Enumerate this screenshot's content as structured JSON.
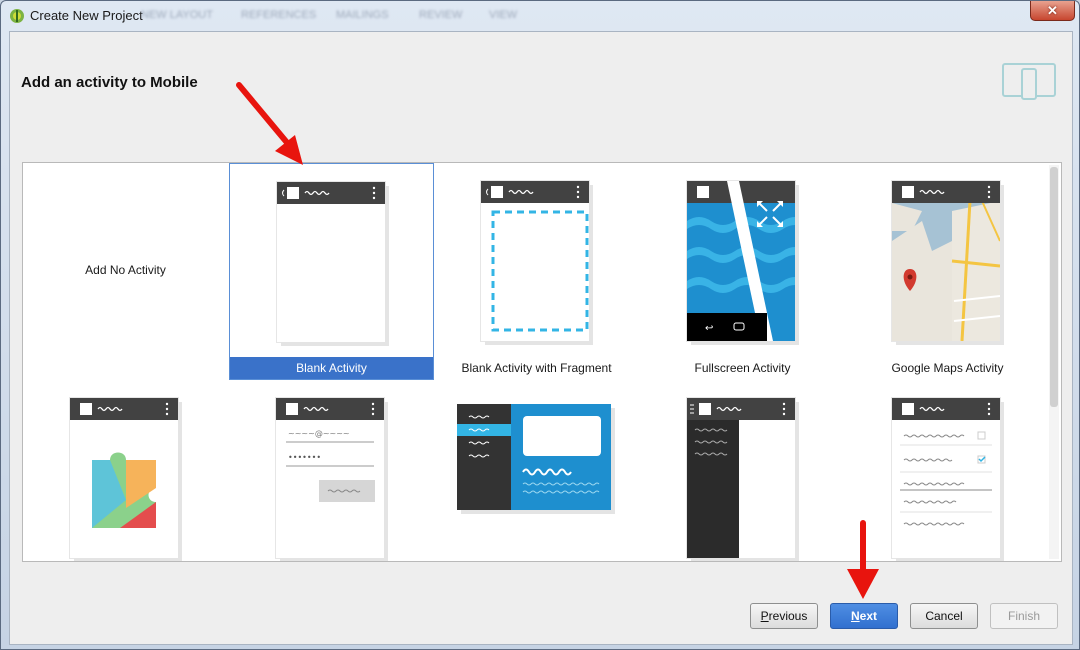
{
  "window": {
    "title": "Create New Project",
    "background_menu": [
      "NEW LAYOUT",
      "REFERENCES",
      "MAILINGS",
      "REVIEW",
      "VIEW"
    ]
  },
  "dialog": {
    "heading": "Add an activity to Mobile",
    "device_icon": "tablet-phone-icon"
  },
  "gallery": {
    "selected": "Blank Activity",
    "templates": [
      {
        "label": "Add No Activity",
        "icon": "none"
      },
      {
        "label": "Blank Activity",
        "icon": "blank-activity-thumbnail"
      },
      {
        "label": "Blank Activity with Fragment",
        "icon": "blank-fragment-thumbnail"
      },
      {
        "label": "Fullscreen Activity",
        "icon": "fullscreen-thumbnail"
      },
      {
        "label": "Google Maps Activity",
        "icon": "google-maps-thumbnail"
      },
      {
        "label": "",
        "icon": "google-play-services-thumbnail"
      },
      {
        "label": "",
        "icon": "login-activity-thumbnail"
      },
      {
        "label": "",
        "icon": "master-detail-flow-thumbnail"
      },
      {
        "label": "",
        "icon": "navigation-drawer-thumbnail"
      },
      {
        "label": "",
        "icon": "settings-activity-thumbnail"
      }
    ],
    "login_thumbnail": {
      "email_placeholder": "~~~~@~~~~",
      "password_placeholder": "•••••••"
    }
  },
  "buttons": {
    "previous": {
      "prefix": "",
      "mnemonic": "P",
      "rest": "revious"
    },
    "next": {
      "prefix": "",
      "mnemonic": "N",
      "rest": "ext"
    },
    "cancel": "Cancel",
    "finish": "Finish"
  },
  "colors": {
    "selection": "#3a72c9",
    "accent_blue": "#33b5e5",
    "arrow_red": "#e8140e",
    "action_bar": "#424242"
  }
}
